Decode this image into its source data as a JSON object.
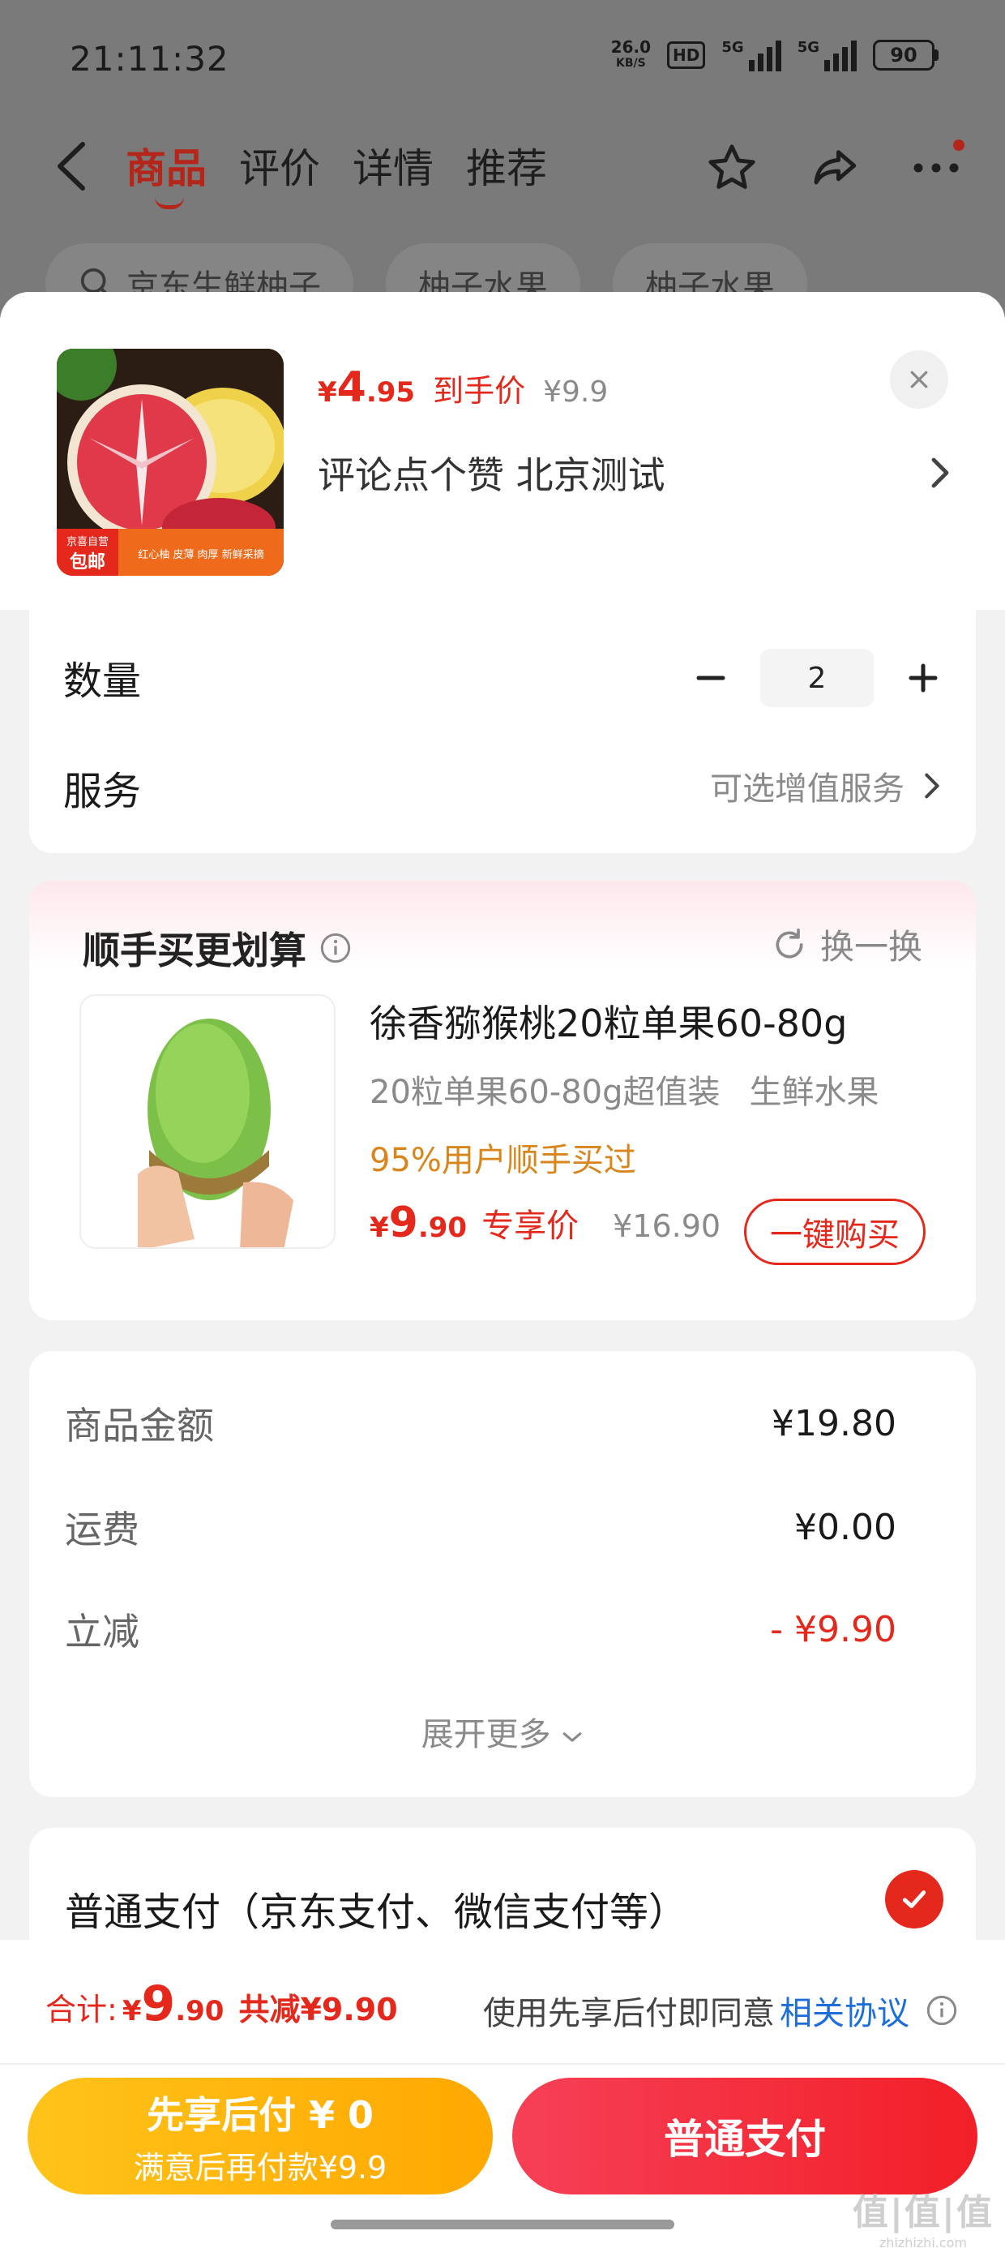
{
  "status_bar": {
    "time": "21:11:32",
    "net_speed_value": "26.0",
    "net_speed_unit": "KB/S",
    "hd_label": "HD",
    "signal1_label": "5G",
    "signal2_label": "5G",
    "battery": "90"
  },
  "nav": {
    "tabs": [
      {
        "label": "商品",
        "active": true
      },
      {
        "label": "评价",
        "active": false
      },
      {
        "label": "详情",
        "active": false
      },
      {
        "label": "推荐",
        "active": false
      }
    ],
    "icons": [
      "back-icon",
      "star-icon",
      "share-icon",
      "more-icon"
    ]
  },
  "background": {
    "chips": [
      "京东生鲜柚子",
      "柚子水果",
      "柚子水果"
    ]
  },
  "product": {
    "thumb_badge_top": "京喜自营",
    "thumb_badge": "包邮",
    "thumb_tagline": "红心柚 皮薄 肉厚 新鲜采摘",
    "price_symbol": "¥",
    "price_int": "4",
    "price_dec": ".95",
    "price_label": "到手价",
    "original_price": "¥9.9",
    "spec": "评论点个赞  北京测试"
  },
  "quantity": {
    "label": "数量",
    "value": "2"
  },
  "service": {
    "label": "服务",
    "value": "可选增值服务"
  },
  "recommend": {
    "title": "顺手买更划算",
    "refresh_label": "换一换",
    "name": "徐香猕猴桃20粒单果60-80g",
    "sub1": "20粒单果60-80g超值装",
    "sub2": "生鲜水果",
    "bought": "95%用户顺手买过",
    "price_symbol": "¥",
    "price_int": "9",
    "price_dec": ".90",
    "price_label": "专享价",
    "original_price": "¥16.90",
    "buy_label": "一键购买"
  },
  "summary": {
    "rows": [
      {
        "label": "商品金额",
        "value": "¥19.80"
      },
      {
        "label": "运费",
        "value": "¥0.00"
      },
      {
        "label": "立减",
        "value": "- ¥9.90"
      }
    ],
    "expand_label": "展开更多"
  },
  "payment": {
    "method_label": "普通支付（京东支付、微信支付等）",
    "selected": true
  },
  "bottom": {
    "total_label": "合计:",
    "total_symbol": "¥",
    "total_int": "9",
    "total_dec": ".90",
    "save_text": "共减¥9.90",
    "agree_text": "使用先享后付即同意",
    "agree_link": "相关协议",
    "later_line1": "先享后付 ¥ 0",
    "later_line2": "满意后再付款¥9.9",
    "pay_label": "普通支付"
  },
  "watermark": {
    "line1": "值|值|值",
    "line2": "zhizhizhi.com"
  },
  "colors": {
    "accent_red": "#e4281c",
    "nav_red": "#b4261a",
    "orange": "#ffa800",
    "link_blue": "#1d6ed8"
  }
}
